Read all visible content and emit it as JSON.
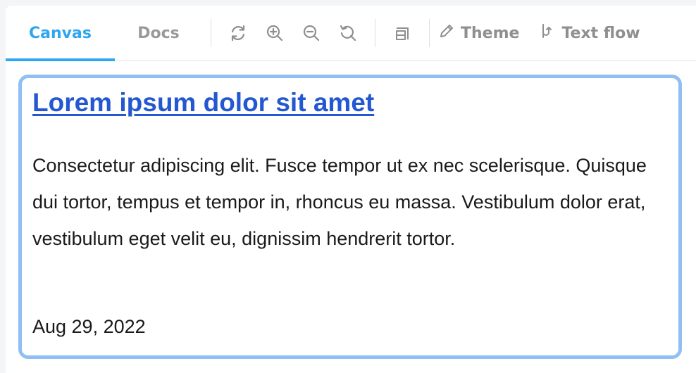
{
  "tabs": [
    {
      "label": "Canvas",
      "active": true
    },
    {
      "label": "Docs",
      "active": false
    }
  ],
  "toolbar": {
    "icons": [
      "refresh-icon",
      "zoom-in-icon",
      "zoom-out-icon",
      "reset-zoom-icon",
      "layout-icon"
    ],
    "theme_label": "Theme",
    "textflow_label": "Text flow"
  },
  "card": {
    "title": "Lorem ipsum dolor sit amet",
    "body": "Consectetur adipiscing elit. Fusce tempor ut ex nec scelerisque. Quisque dui tortor, tempus et tempor in, rhoncus eu massa. Vestibulum dolor erat, vestibulum eget velit eu, dignissim hendrerit tortor.",
    "date": "Aug 29, 2022"
  },
  "colors": {
    "accent": "#2ea6f0",
    "link": "#2458d1",
    "card_border": "#8fbff3",
    "toolbar_text": "#8f8f8f"
  }
}
